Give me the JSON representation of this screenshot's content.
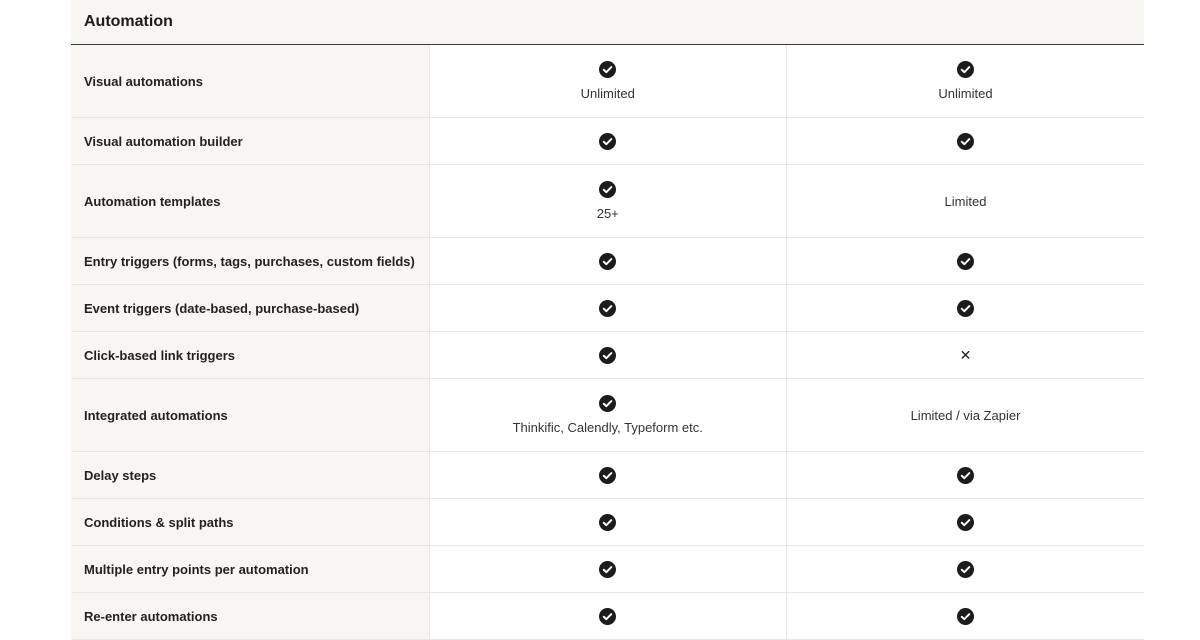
{
  "section": {
    "title": "Automation"
  },
  "rows": [
    {
      "feature": "Visual automations",
      "a": {
        "icon": "check-circle-icon",
        "note": "Unlimited"
      },
      "b": {
        "icon": "check-circle-icon",
        "note": "Unlimited"
      }
    },
    {
      "feature": "Visual automation builder",
      "a": {
        "icon": "check-circle-icon"
      },
      "b": {
        "icon": "check-circle-icon"
      }
    },
    {
      "feature": "Automation templates",
      "a": {
        "icon": "check-circle-icon",
        "note": "25+"
      },
      "b": {
        "text": "Limited"
      }
    },
    {
      "feature": "Entry triggers (forms, tags, purchases, custom fields)",
      "a": {
        "icon": "check-circle-icon"
      },
      "b": {
        "icon": "check-circle-icon"
      }
    },
    {
      "feature": "Event triggers (date-based, purchase-based)",
      "a": {
        "icon": "check-circle-icon"
      },
      "b": {
        "icon": "check-circle-icon"
      }
    },
    {
      "feature": "Click-based link triggers",
      "a": {
        "icon": "check-circle-icon"
      },
      "b": {
        "icon": "cross-icon",
        "text": "✕"
      }
    },
    {
      "feature": "Integrated automations",
      "a": {
        "icon": "check-circle-icon",
        "note": "Thinkific, Calendly, Typeform etc."
      },
      "b": {
        "text": "Limited / via Zapier"
      }
    },
    {
      "feature": "Delay steps",
      "a": {
        "icon": "check-circle-icon"
      },
      "b": {
        "icon": "check-circle-icon"
      }
    },
    {
      "feature": "Conditions & split paths",
      "a": {
        "icon": "check-circle-icon"
      },
      "b": {
        "icon": "check-circle-icon"
      }
    },
    {
      "feature": "Multiple entry points per automation",
      "a": {
        "icon": "check-circle-icon"
      },
      "b": {
        "icon": "check-circle-icon"
      }
    },
    {
      "feature": "Re-enter automations",
      "a": {
        "icon": "check-circle-icon"
      },
      "b": {
        "icon": "check-circle-icon"
      }
    }
  ],
  "colors": {
    "header_bg": "#f8f6f2",
    "check": "#1c1c1c",
    "border": "#e8e6e2"
  }
}
